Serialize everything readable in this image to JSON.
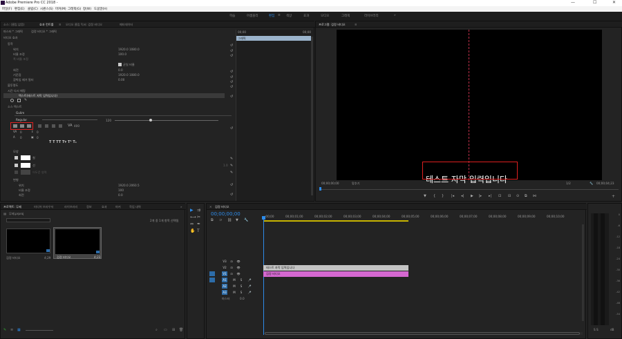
{
  "app": {
    "title": "Adobe Premiere Pro CC 2018 - ",
    "minimize": "—",
    "maximize": "☐",
    "close": "✕"
  },
  "menu": [
    "파일(F)",
    "편집(E)",
    "클립(C)",
    "시퀀스(S)",
    "마커(M)",
    "그래픽(G)",
    "창(W)",
    "도움말(H)"
  ],
  "workspaces": [
    "학습",
    "어셈블리",
    "편집",
    "색상",
    "효과",
    "오디오",
    "그래픽",
    "라이브러리"
  ],
  "workspace_menu_icon": "≡",
  "ws_more": "»",
  "effect_controls": {
    "tabs": [
      "소스: (클립 없음)",
      "효과 컨트롤",
      "오디오 클립 믹서: 검정 비디오",
      "메타데이터"
    ],
    "tab_menu": "≡",
    "breadcrumb_a": "마스터 * 그래픽",
    "breadcrumb_b": "검정 비디오 * 그래픽",
    "section_video": "비디오 효과",
    "motion": "동작",
    "position": "위치",
    "position_val": "1920.0   1080.0",
    "scale": "비율 조정",
    "scale_val": "100.0",
    "scale_width": "폭 비율 조정",
    "uniform_scale": "균일 비율",
    "rotation": "회전",
    "rotation_val": "0.0",
    "anchor": "기준점",
    "anchor_val": "1920.0   1080.0",
    "antiflicker": "깜박임 제거 필터",
    "antiflicker_val": "0.00",
    "opacity": "불투명도",
    "time_remap": "시간 다시 매핑",
    "layer": "텍스트(테스트 자막 입력입니다)",
    "source_text": "소스 텍스트",
    "font": "Gulim",
    "font_style": "Regular",
    "font_size": "120",
    "tracking_val": "400",
    "kerning_val": "0",
    "leading_val": "0",
    "baseline_val": "0",
    "tsume_val": "0",
    "appearance": "모양",
    "fill": "칠",
    "stroke": "선",
    "stroke_val": "1.0",
    "shadow": "어두운 영역",
    "transform": "변형",
    "t_position": "위치",
    "t_position_val": "1920.0   2060.5",
    "t_scale": "비율 조정",
    "t_scale_val": "100",
    "t_rotation": "회전",
    "t_rotation_val": "0.0",
    "text_style_icons": "T  T  TT  Tт  T¹  T₁",
    "mini_label": "그래픽",
    "mini_time_start": "00;00",
    "mini_time_end": "00;00"
  },
  "program": {
    "title": "프로그램: 검정 비디오",
    "menu_icon": "≡",
    "caption": "테스트 자막 입력입니다",
    "timecode": "00;00;00;00",
    "fit": "맞추기",
    "quality": "1/2",
    "duration": "00;00;04;23",
    "btn_marker": "▼",
    "btn_in": "{",
    "btn_out": "}",
    "btn_goin": "|◂",
    "btn_stepback": "◂|",
    "btn_play": "▶",
    "btn_stepfwd": "|▸",
    "btn_goout": "▸|",
    "btn_lift": "⊡",
    "btn_extract": "⊟",
    "btn_export": "⊙",
    "btn_compare": "⧉",
    "btn_more": "⋈",
    "btn_add": "+",
    "btn_wrench": "🔧"
  },
  "project": {
    "tabs": [
      "프로젝트: 무제",
      "미디어 브라우저",
      "라이브러리",
      "정보",
      "효과",
      "마커",
      "작업 내역"
    ],
    "more": "»",
    "bin": "무제.prproj",
    "search_placeholder": "",
    "count": "2개 중 1개 항목 선택됨",
    "items": [
      {
        "name": "검정 비디오",
        "dur": "4;29"
      },
      {
        "name": "검정 비디오",
        "dur": "4;23"
      }
    ]
  },
  "timeline": {
    "title": "검정 비디오",
    "timecode": "00;00;00;00",
    "ruler": [
      ":00;00",
      "00;00;01;00",
      "00;00;02;00",
      "00;00;03;00",
      "00;00;04;00",
      "00;00;05;00",
      "00;00;06;00",
      "00;00;07;00",
      "00;00;08;00",
      "00;00;09;00",
      "00;00;10;00"
    ],
    "tracks": [
      {
        "name": "V3",
        "lock": "🔒",
        "eye": "👁",
        "sync": "⊡"
      },
      {
        "name": "V2",
        "lock": "🔒",
        "eye": "👁",
        "sync": "⊡"
      },
      {
        "name": "V1",
        "lock": "🔒",
        "eye": "👁",
        "sync": "⊡"
      },
      {
        "name": "A1",
        "m": "M",
        "s": "S",
        "mic": "🎤"
      },
      {
        "name": "A2",
        "m": "M",
        "s": "S",
        "mic": "🎤"
      },
      {
        "name": "A3",
        "m": "M",
        "s": "S",
        "mic": "🎤"
      },
      {
        "name": "마스터",
        "val": "0.0"
      }
    ],
    "clip_v2": "테스트 자막 입력입니다",
    "clip_v1": "검정 비디오"
  },
  "meter_scale": [
    "0",
    "-6",
    "-12",
    "-18",
    "-24",
    "-30",
    "-36",
    "-42",
    "-48",
    "-54"
  ],
  "meter_labels": "S  S",
  "meter_db": "dB",
  "colors": {
    "accent": "#2d8ceb",
    "clip_v2": "#c4c4c4",
    "clip_v1": "#d468d0",
    "redbox": "#e02020"
  }
}
